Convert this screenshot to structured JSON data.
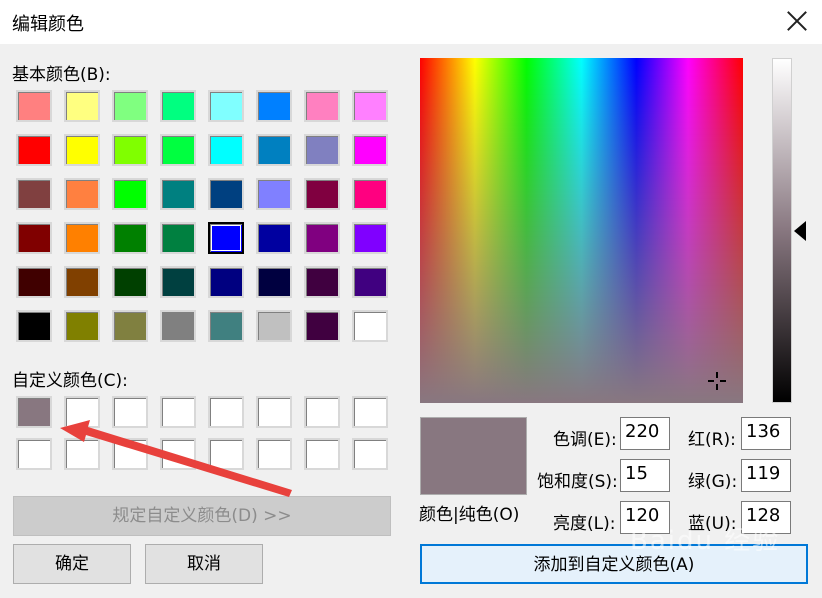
{
  "title": "编辑颜色",
  "basic_label": "基本颜色(B):",
  "custom_label": "自定义颜色(C):",
  "basic_colors": [
    [
      "#ff8080",
      "#ffff80",
      "#80ff80",
      "#00ff80",
      "#80ffff",
      "#0080ff",
      "#ff80c0",
      "#ff80ff"
    ],
    [
      "#ff0000",
      "#ffff00",
      "#80ff00",
      "#00ff40",
      "#00ffff",
      "#0080c0",
      "#8080c0",
      "#ff00ff"
    ],
    [
      "#804040",
      "#ff8040",
      "#00ff00",
      "#008080",
      "#004080",
      "#8080ff",
      "#800040",
      "#ff0080"
    ],
    [
      "#800000",
      "#ff8000",
      "#008000",
      "#008040",
      "#0000ff",
      "#0000a0",
      "#800080",
      "#8000ff"
    ],
    [
      "#400000",
      "#804000",
      "#004000",
      "#004040",
      "#000080",
      "#000040",
      "#400040",
      "#400080"
    ],
    [
      "#000000",
      "#808000",
      "#808040",
      "#808080",
      "#408080",
      "#c0c0c0",
      "#400040",
      "#ffffff"
    ]
  ],
  "selected_basic": {
    "row": 3,
    "col": 4
  },
  "custom_colors": [
    [
      "#887780",
      "#ffffff",
      "#ffffff",
      "#ffffff",
      "#ffffff",
      "#ffffff",
      "#ffffff",
      "#ffffff"
    ],
    [
      "#ffffff",
      "#ffffff",
      "#ffffff",
      "#ffffff",
      "#ffffff",
      "#ffffff",
      "#ffffff",
      "#ffffff"
    ]
  ],
  "define_custom_button": "规定自定义颜色(D) >>",
  "ok_button": "确定",
  "cancel_button": "取消",
  "color_solid_label": "颜色|纯色(O)",
  "hue_label": "色调(E):",
  "sat_label": "饱和度(S):",
  "lum_label": "亮度(L):",
  "red_label": "红(R):",
  "green_label": "绿(G):",
  "blue_label": "蓝(U):",
  "hue": "220",
  "sat": "15",
  "lum": "120",
  "red": "136",
  "green": "119",
  "blue": "128",
  "add_custom_button": "添加到自定义颜色(A)",
  "current_color": "#887780",
  "annotation_arrow_color": "#e8413c",
  "watermark": "Baidu 经验"
}
